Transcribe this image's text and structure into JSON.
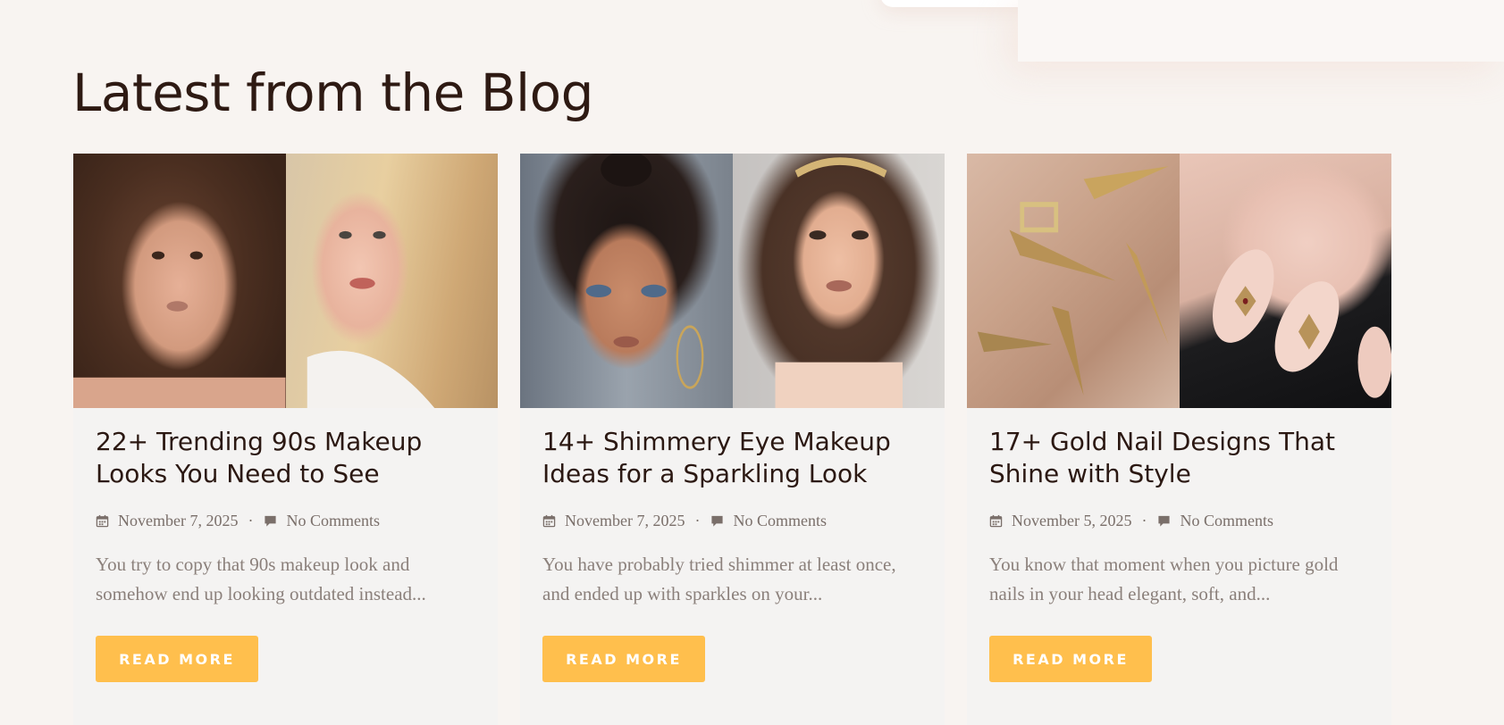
{
  "section": {
    "title": "Latest from the Blog"
  },
  "posts": [
    {
      "title": "22+ Trending 90s Makeup Looks You Need to See",
      "date": "November 7, 2025",
      "comments": "No Comments",
      "excerpt": "You try to copy that 90s makeup look and somehow end up looking outdated instead...",
      "button": "READ MORE"
    },
    {
      "title": "14+ Shimmery Eye Makeup Ideas for a Sparkling Look",
      "date": "November 7, 2025",
      "comments": "No Comments",
      "excerpt": "You have probably tried shimmer at least once, and ended up with sparkles on your...",
      "button": "READ MORE"
    },
    {
      "title": "17+ Gold Nail Designs That Shine with Style",
      "date": "November 5, 2025",
      "comments": "No Comments",
      "excerpt": "You know that moment when you picture gold nails in your head elegant, soft, and...",
      "button": "READ MORE"
    }
  ],
  "icons": {
    "date": "calendar-icon",
    "comments": "comment-icon"
  },
  "colors": {
    "accent": "#ffbf4d",
    "background": "#f8f4f1",
    "card": "#f4f3f2",
    "title": "#2e1a13",
    "meta": "#7a6f6a"
  }
}
